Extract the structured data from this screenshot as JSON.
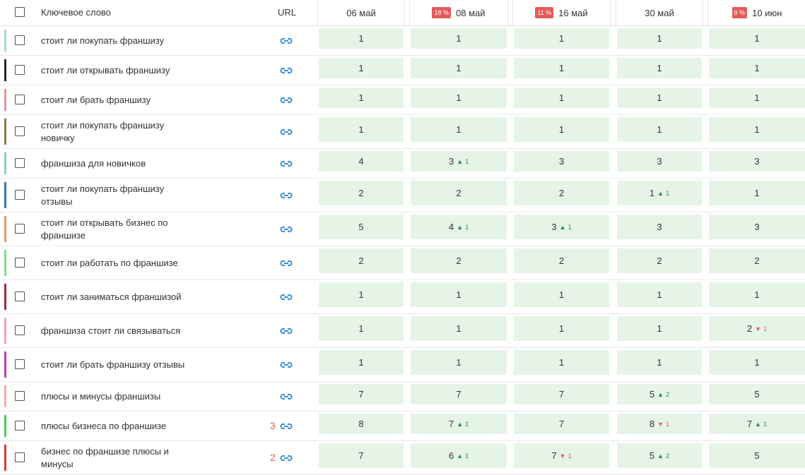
{
  "header": {
    "keyword_label": "Ключевое слово",
    "url_label": "URL",
    "dates": [
      {
        "label": "06 май",
        "badge": ""
      },
      {
        "label": "08 май",
        "badge": "18 %"
      },
      {
        "label": "16 май",
        "badge": "11 %"
      },
      {
        "label": "30 май",
        "badge": ""
      },
      {
        "label": "10 июн",
        "badge": "9 %"
      }
    ]
  },
  "rows": [
    {
      "keyword": "стоит ли покупать франшизу",
      "color": "#a8dcc8",
      "url_count": "",
      "positions": [
        {
          "value": "1"
        },
        {
          "value": "1"
        },
        {
          "value": "1"
        },
        {
          "value": "1"
        },
        {
          "value": "1"
        }
      ]
    },
    {
      "keyword": "стоит ли открывать франшизу",
      "color": "#1b2a35",
      "url_count": "",
      "positions": [
        {
          "value": "1"
        },
        {
          "value": "1"
        },
        {
          "value": "1"
        },
        {
          "value": "1"
        },
        {
          "value": "1"
        }
      ]
    },
    {
      "keyword": "стоит ли брать франшизу",
      "color": "#d99a9a",
      "url_count": "",
      "positions": [
        {
          "value": "1"
        },
        {
          "value": "1"
        },
        {
          "value": "1"
        },
        {
          "value": "1"
        },
        {
          "value": "1"
        }
      ]
    },
    {
      "keyword": "стоит ли покупать франшизу новичку",
      "color": "#8a7a50",
      "url_count": "",
      "positions": [
        {
          "value": "1"
        },
        {
          "value": "1"
        },
        {
          "value": "1"
        },
        {
          "value": "1"
        },
        {
          "value": "1"
        }
      ]
    },
    {
      "keyword": "франшиза для новичков",
      "color": "#8fd0a8",
      "url_count": "",
      "positions": [
        {
          "value": "4"
        },
        {
          "value": "3",
          "delta": "1",
          "dir": "up"
        },
        {
          "value": "3"
        },
        {
          "value": "3"
        },
        {
          "value": "3"
        }
      ]
    },
    {
      "keyword": "стоит ли покупать франшизу отзывы",
      "color": "#3577b5",
      "url_count": "",
      "positions": [
        {
          "value": "2"
        },
        {
          "value": "2"
        },
        {
          "value": "2"
        },
        {
          "value": "1",
          "delta": "1",
          "dir": "up"
        },
        {
          "value": "1"
        }
      ]
    },
    {
      "keyword": "стоит ли открывать бизнес по франшизе",
      "color": "#e8956a",
      "url_count": "",
      "positions": [
        {
          "value": "5"
        },
        {
          "value": "4",
          "delta": "1",
          "dir": "up"
        },
        {
          "value": "3",
          "delta": "1",
          "dir": "up"
        },
        {
          "value": "3"
        },
        {
          "value": "3"
        }
      ]
    },
    {
      "keyword": "стоит ли работать по франшизе",
      "color": "#86e08a",
      "url_count": "",
      "positions": [
        {
          "value": "2"
        },
        {
          "value": "2"
        },
        {
          "value": "2"
        },
        {
          "value": "2"
        },
        {
          "value": "2"
        }
      ]
    },
    {
      "keyword": "стоит ли заниматься франшизой",
      "color": "#9a2c3a",
      "url_count": "",
      "positions": [
        {
          "value": "1"
        },
        {
          "value": "1"
        },
        {
          "value": "1"
        },
        {
          "value": "1"
        },
        {
          "value": "1"
        }
      ]
    },
    {
      "keyword": "франшиза стоит ли связываться",
      "color": "#eaa6ba",
      "url_count": "",
      "positions": [
        {
          "value": "1"
        },
        {
          "value": "1"
        },
        {
          "value": "1"
        },
        {
          "value": "1"
        },
        {
          "value": "2",
          "delta": "1",
          "dir": "down"
        }
      ]
    },
    {
      "keyword": "стоит ли брать франшизу отзывы",
      "color": "#c23aa8",
      "url_count": "",
      "positions": [
        {
          "value": "1"
        },
        {
          "value": "1"
        },
        {
          "value": "1"
        },
        {
          "value": "1"
        },
        {
          "value": "1"
        }
      ]
    },
    {
      "keyword": "плюсы и минусы франшизы",
      "color": "#eab0a4",
      "url_count": "",
      "positions": [
        {
          "value": "7"
        },
        {
          "value": "7"
        },
        {
          "value": "7"
        },
        {
          "value": "5",
          "delta": "2",
          "dir": "up"
        },
        {
          "value": "5"
        }
      ]
    },
    {
      "keyword": "плюсы бизнеса по франшизе",
      "color": "#3fcf5a",
      "url_count": "3",
      "positions": [
        {
          "value": "8"
        },
        {
          "value": "7",
          "delta": "1",
          "dir": "up"
        },
        {
          "value": "7"
        },
        {
          "value": "8",
          "delta": "1",
          "dir": "down"
        },
        {
          "value": "7",
          "delta": "1",
          "dir": "up"
        }
      ]
    },
    {
      "keyword": "бизнес по франшизе плюсы и минусы",
      "color": "#d83a3a",
      "url_count": "2",
      "positions": [
        {
          "value": "7"
        },
        {
          "value": "6",
          "delta": "1",
          "dir": "up"
        },
        {
          "value": "7",
          "delta": "1",
          "dir": "down"
        },
        {
          "value": "5",
          "delta": "2",
          "dir": "up"
        },
        {
          "value": "5"
        }
      ]
    }
  ],
  "icons": {
    "url": "link-icon",
    "up": "triangle-up-icon",
    "down": "triangle-down-icon"
  }
}
